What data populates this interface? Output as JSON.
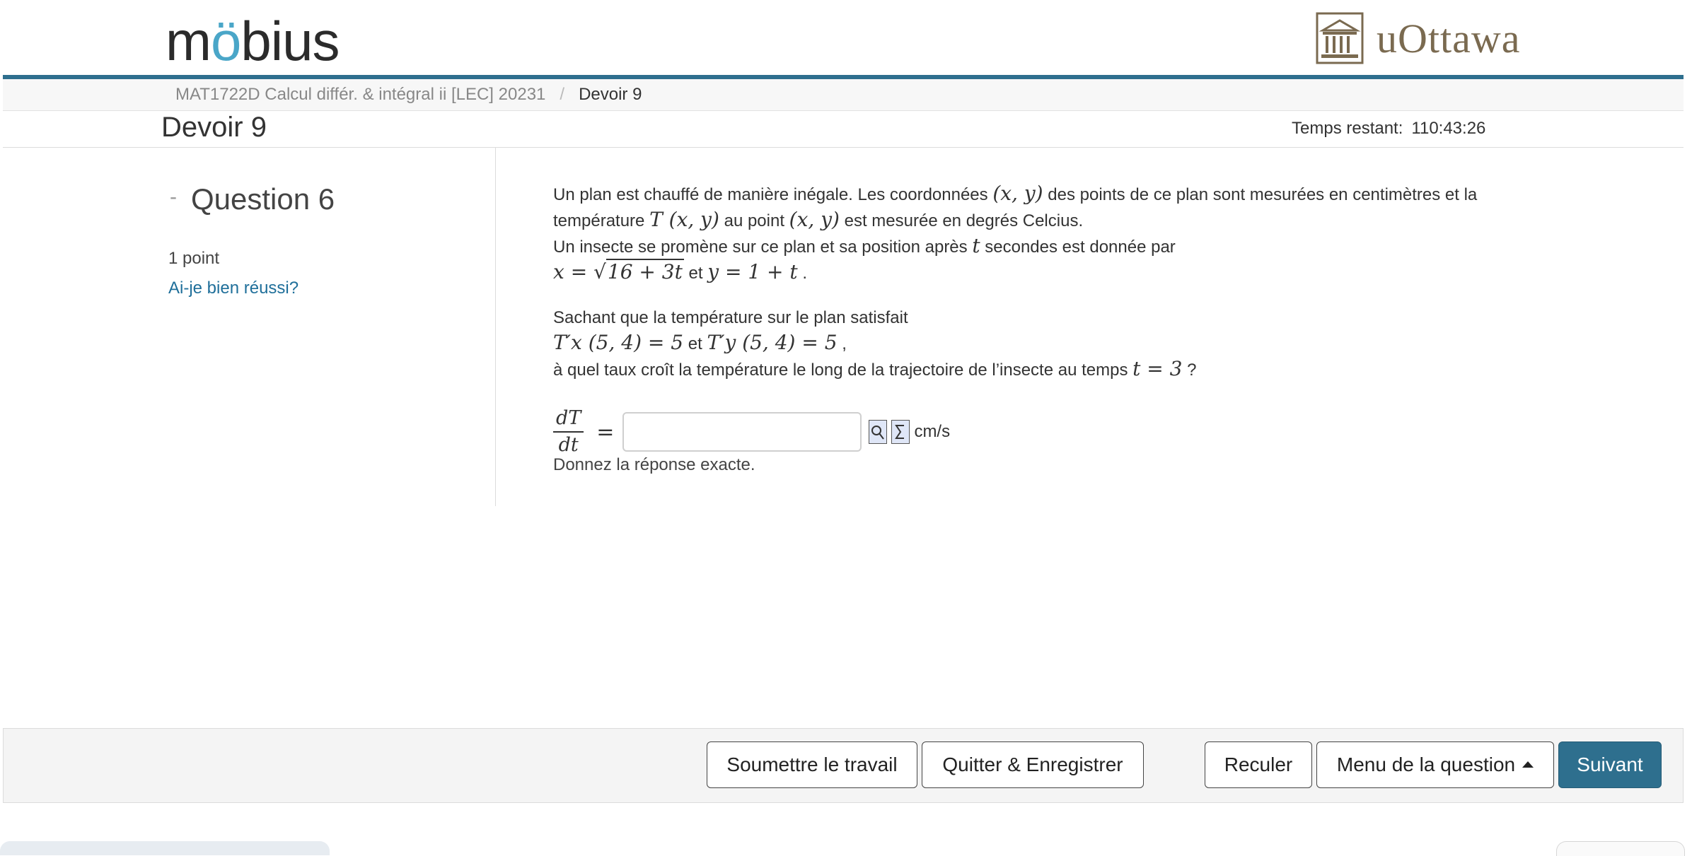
{
  "header": {
    "logo_text": "möbius",
    "institution_text": "uOttawa"
  },
  "breadcrumb": {
    "course": "MAT1722D Calcul différ. & intégral ii [LEC] 20231",
    "separator": "/",
    "current": "Devoir 9"
  },
  "page": {
    "title": "Devoir 9",
    "timer_label": "Temps restant:",
    "timer_value": "110:43:26"
  },
  "question": {
    "collapse_symbol": "-",
    "title": "Question 6",
    "points": "1 point",
    "check_link": "Ai-je bien réussi?"
  },
  "content": {
    "p1a": "Un plan est chauffé de manière inégale. Les coordonnées",
    "xy": "(x, y)",
    "p1b": "des points de ce plan sont mesurées en centimètres et la",
    "p2a": "température",
    "Txy": "T (x, y)",
    "p2b": "au point",
    "p2c": "est mesurée en degrés Celcius.",
    "p3a": "Un insecte se promène sur ce plan et sa position après",
    "t": "t",
    "p3b": "secondes est donnée par",
    "x_eq": "x = ",
    "sqrt_arg": "16 + 3t",
    "et": "et",
    "y_eq": "y = 1 + t",
    "dot": ".",
    "p4": "Sachant que la température sur le plan satisfait",
    "Tx": "T′x  (5, 4) = 5",
    "Ty": "T′y  (5, 4) = 5",
    "comma": ",",
    "p5a": "à quel taux croît la température le long de la trajectoire de l’insecte au temps",
    "t3": "t = 3",
    "p5b": "?"
  },
  "answer": {
    "frac_num": "dT",
    "frac_den": "dt",
    "equals": "=",
    "value": "",
    "placeholder": "",
    "unit": "cm/s",
    "hint": "Donnez la réponse exacte."
  },
  "footer": {
    "submit": "Soumettre le travail",
    "quit": "Quitter & Enregistrer",
    "back": "Reculer",
    "menu": "Menu de la question",
    "next": "Suivant"
  },
  "colors": {
    "accent": "#2e6f8e",
    "link": "#1f6f9a",
    "logo_o": "#4aa6c8",
    "uottawa": "#7a6a50"
  }
}
